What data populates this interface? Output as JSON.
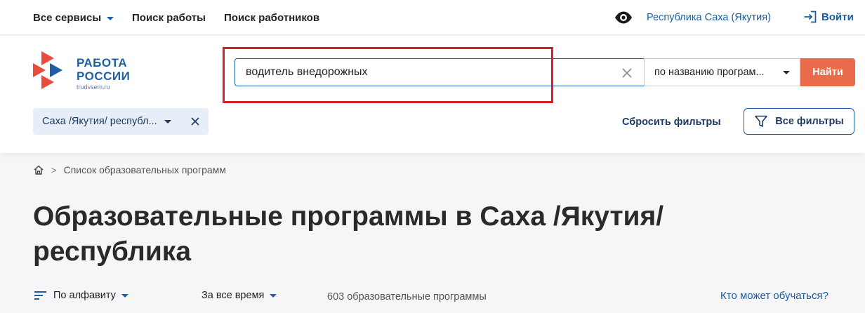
{
  "topbar": {
    "all_services": "Все сервисы",
    "job_search": "Поиск работы",
    "worker_search": "Поиск работников",
    "region": "Республика Саха (Якутия)",
    "login": "Войти"
  },
  "logo": {
    "line1": "РАБОТА",
    "line2": "РОССИИ",
    "domain": "trudvsem.ru"
  },
  "search": {
    "value": "водитель внедорожных",
    "mode": "по названию програм...",
    "button": "Найти"
  },
  "filters": {
    "region_chip": "Саха /Якутия/ республ...",
    "reset": "Сбросить фильтры",
    "all_filters": "Все фильтры"
  },
  "breadcrumb": {
    "current": "Список образовательных программ"
  },
  "page": {
    "title": "Образовательные программы в Саха /Якутия/ республика"
  },
  "sortbar": {
    "sort": "По алфавиту",
    "period": "За все время",
    "count": "603 образовательные программы",
    "who_can_study": "Кто может обучаться?"
  },
  "colors": {
    "accent": "#1a5ea5",
    "button": "#ea6b4b",
    "highlight_frame": "#d3212a"
  }
}
